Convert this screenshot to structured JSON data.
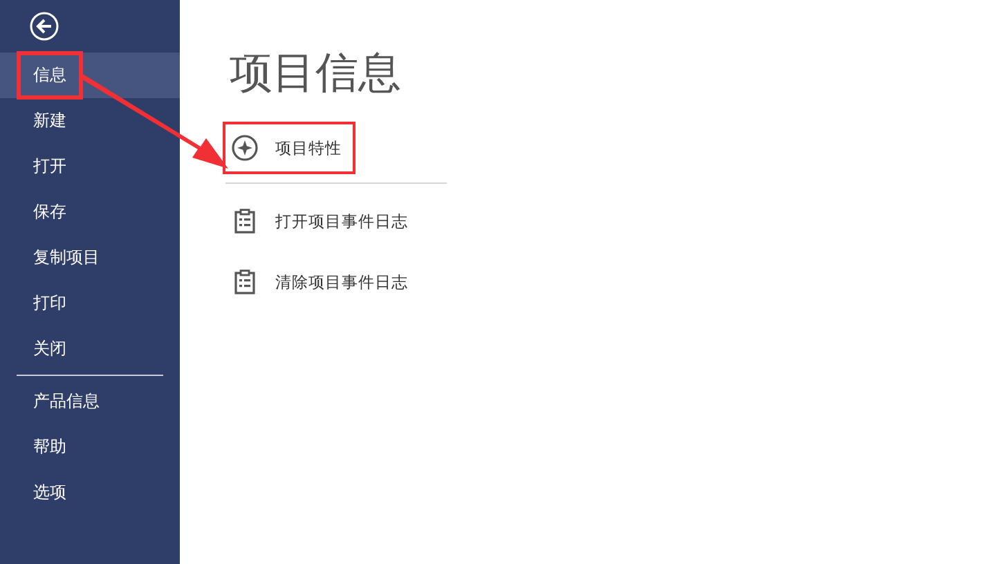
{
  "sidebar": {
    "items": [
      {
        "label": "信息",
        "selected": true,
        "highlighted": true
      },
      {
        "label": "新建",
        "selected": false,
        "highlighted": false
      },
      {
        "label": "打开",
        "selected": false,
        "highlighted": false
      },
      {
        "label": "保存",
        "selected": false,
        "highlighted": false
      },
      {
        "label": "复制项目",
        "selected": false,
        "highlighted": false
      },
      {
        "label": "打印",
        "selected": false,
        "highlighted": false
      },
      {
        "label": "关闭",
        "selected": false,
        "highlighted": false,
        "divider_after": true
      },
      {
        "label": "产品信息",
        "selected": false,
        "highlighted": false
      },
      {
        "label": "帮助",
        "selected": false,
        "highlighted": false
      },
      {
        "label": "选项",
        "selected": false,
        "highlighted": false
      }
    ]
  },
  "main": {
    "title": "项目信息",
    "actions": [
      {
        "label": "项目特性",
        "kind": "properties",
        "highlighted": true,
        "divider_after": true
      },
      {
        "label": "打开项目事件日志",
        "kind": "log",
        "highlighted": false
      },
      {
        "label": "清除项目事件日志",
        "kind": "log",
        "highlighted": false
      }
    ]
  }
}
